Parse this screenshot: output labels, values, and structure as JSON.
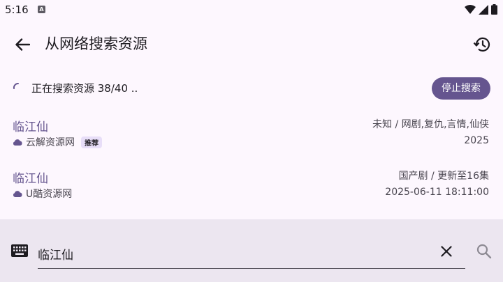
{
  "status_bar": {
    "time": "5:16",
    "notification_letter": "A"
  },
  "header": {
    "title": "从网络搜索资源",
    "back_icon": "arrow-back-icon",
    "history_icon": "history-icon"
  },
  "progress": {
    "text": "正在搜索资源 38/40 ..",
    "stop_label": "停止搜索"
  },
  "results": [
    {
      "title": "临江仙",
      "source": "云解资源网",
      "tag": "推荐",
      "meta_line1": "未知 / 网剧,复仇,言情,仙侠",
      "meta_line2": "2025"
    },
    {
      "title": "临江仙",
      "source": "U酷资源网",
      "tag": "",
      "meta_line1": "国产剧 / 更新至16集",
      "meta_line2": "2025-06-11 18:11:00"
    }
  ],
  "search": {
    "value": "临江仙",
    "keyboard_icon": "keyboard-icon",
    "clear_icon": "close-icon",
    "search_icon": "search-icon"
  },
  "colors": {
    "accent": "#65558f",
    "background": "#fdf7fe",
    "panel": "#ece6f0",
    "tag_bg": "#e8def8"
  }
}
